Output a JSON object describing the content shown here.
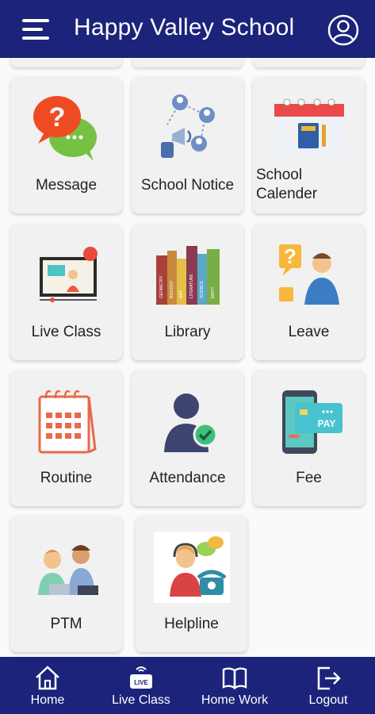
{
  "header": {
    "title": "Happy Valley School",
    "menu_icon": "hamburger-menu-icon",
    "profile_icon": "user-circle-icon"
  },
  "tiles": [
    {
      "label": "Message",
      "icon": "chat-bubbles-icon"
    },
    {
      "label": "School Notice",
      "icon": "announcement-network-icon"
    },
    {
      "label": "School Calender",
      "icon": "calendar-book-icon"
    },
    {
      "label": "Live Class",
      "icon": "video-lesson-icon"
    },
    {
      "label": "Library",
      "icon": "books-icon"
    },
    {
      "label": "Leave",
      "icon": "person-question-icon"
    },
    {
      "label": "Routine",
      "icon": "routine-calendar-icon"
    },
    {
      "label": "Attendance",
      "icon": "user-check-icon"
    },
    {
      "label": "Fee",
      "icon": "phone-pay-icon"
    },
    {
      "label": "PTM",
      "icon": "parent-teacher-meeting-icon"
    },
    {
      "label": "Helpline",
      "icon": "helpline-support-icon"
    }
  ],
  "library_books": [
    "GEOMETRY",
    "BIOLOGY",
    "ART",
    "LITERATURE",
    "SCIENCE",
    "MATH"
  ],
  "fee_pay_text": "PAY",
  "bottom_nav": [
    {
      "label": "Home",
      "icon": "home-icon"
    },
    {
      "label": "Live Class",
      "icon": "live-tv-icon",
      "badge": "LIVE"
    },
    {
      "label": "Home Work",
      "icon": "open-book-icon"
    },
    {
      "label": "Logout",
      "icon": "logout-icon"
    }
  ],
  "colors": {
    "primary": "#1b237a",
    "tile_bg": "#f1f1f1",
    "background": "#fafafa"
  }
}
